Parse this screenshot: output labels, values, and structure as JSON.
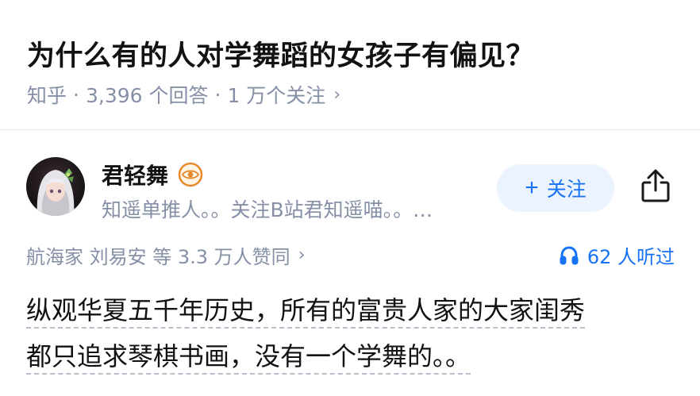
{
  "question": {
    "title": "为什么有的人对学舞蹈的女孩子有偏见？",
    "source": "知乎",
    "answers": "3,396 个回答",
    "followers": "1 万个关注",
    "separator": "·",
    "chevron": "›"
  },
  "author": {
    "name": "君轻舞",
    "badge_icon": "eye-badge-icon",
    "bio": "知遥单推人。。关注B站君知遥喵。。…",
    "follow_label": "关注",
    "follow_plus": "+",
    "share_icon": "share-icon"
  },
  "stats": {
    "voters": "航海家 刘易安 等 3.3 万人赞同",
    "chevron": "›",
    "listens": "62 人听过",
    "listen_icon": "headphones-icon"
  },
  "answer": {
    "line1": "纵观华夏五千年历史，所有的富贵人家的大家闺秀",
    "line2": "都只追求琴棋书画，没有一个学舞的。。"
  },
  "colors": {
    "accent": "#1772f6",
    "follow_bg": "#ebf3ff",
    "meta": "#8590a6",
    "title": "#121212",
    "badge": "#e58a2e"
  }
}
